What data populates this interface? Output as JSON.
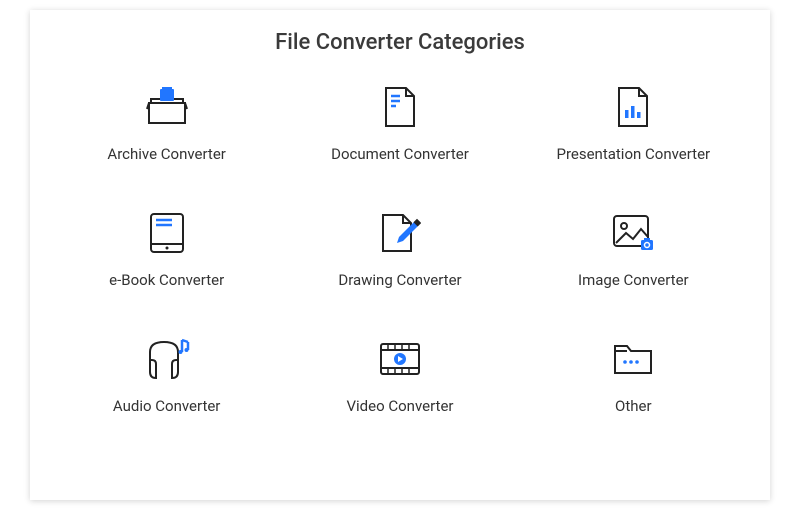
{
  "title": "File Converter Categories",
  "categories": [
    {
      "label": "Archive Converter",
      "icon": "archive"
    },
    {
      "label": "Document Converter",
      "icon": "document"
    },
    {
      "label": "Presentation Converter",
      "icon": "presentation"
    },
    {
      "label": "e-Book Converter",
      "icon": "ebook"
    },
    {
      "label": "Drawing Converter",
      "icon": "drawing"
    },
    {
      "label": "Image Converter",
      "icon": "image"
    },
    {
      "label": "Audio Converter",
      "icon": "audio"
    },
    {
      "label": "Video Converter",
      "icon": "video"
    },
    {
      "label": "Other",
      "icon": "other"
    }
  ],
  "colors": {
    "accent": "#2176ff",
    "stroke": "#222"
  }
}
